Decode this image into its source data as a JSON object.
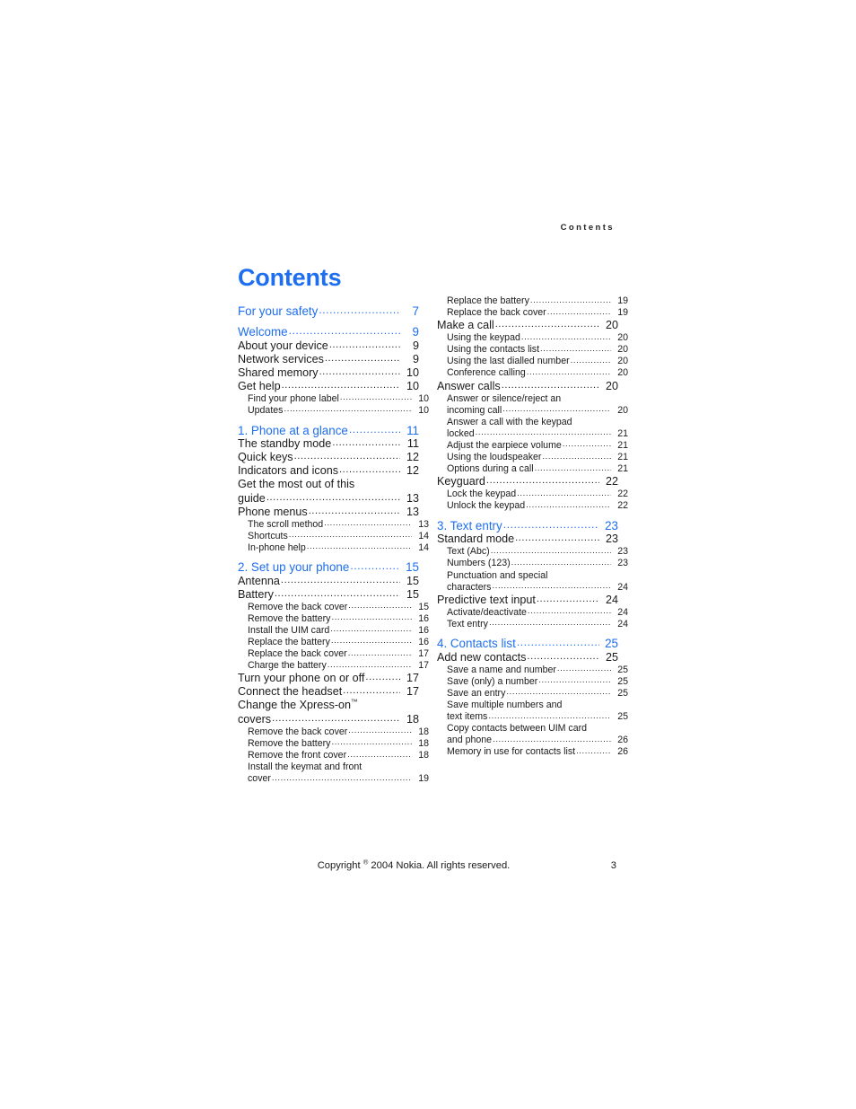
{
  "running_header": "Contents",
  "page_title": "Contents",
  "colors": {
    "chapter_blue": "#1d6ef0",
    "body_black": "#1a1a1a",
    "page_background": "#ffffff"
  },
  "footer": {
    "copyright": "Copyright © 2004 Nokia. All rights reserved.",
    "copyright_prefix": "Copyright ",
    "copyright_symbol": "®",
    "copyright_suffix": " 2004 Nokia. All rights reserved.",
    "folio": "3"
  },
  "toc": {
    "left_column": [
      {
        "level": "chapter",
        "label": "For your safety",
        "page": "7"
      },
      {
        "level": "chapter",
        "label": "Welcome",
        "page": "9"
      },
      {
        "level": "1",
        "label": "About your device",
        "page": "9"
      },
      {
        "level": "1",
        "label": "Network services",
        "page": "9"
      },
      {
        "level": "1",
        "label": "Shared memory ",
        "page": "10"
      },
      {
        "level": "1",
        "label": "Get help",
        "page": "10"
      },
      {
        "level": "2",
        "label": "Find your phone label",
        "page": "10"
      },
      {
        "level": "2",
        "label": "Updates",
        "page": "10"
      },
      {
        "level": "chapter",
        "label": "1. Phone at a glance",
        "page": "11"
      },
      {
        "level": "1",
        "label": "The standby mode",
        "page": "11"
      },
      {
        "level": "1",
        "label": "Quick keys",
        "page": "12"
      },
      {
        "level": "1",
        "label": "Indicators and icons",
        "page": "12"
      },
      {
        "level": "1",
        "label": "Get the most out of this",
        "wrap_first": true
      },
      {
        "level": "1",
        "label": "guide",
        "page": "13"
      },
      {
        "level": "1",
        "label": "Phone menus",
        "page": "13"
      },
      {
        "level": "2",
        "label": "The scroll method ",
        "page": "13"
      },
      {
        "level": "2",
        "label": "Shortcuts",
        "page": "14"
      },
      {
        "level": "2",
        "label": "In-phone help ",
        "page": "14"
      },
      {
        "level": "chapter",
        "label": "2. Set up your phone",
        "page": "15"
      },
      {
        "level": "1",
        "label": "Antenna ",
        "page": "15"
      },
      {
        "level": "1",
        "label": "Battery ",
        "page": "15"
      },
      {
        "level": "2",
        "label": "Remove the back cover ",
        "page": "15"
      },
      {
        "level": "2",
        "label": "Remove the battery",
        "page": "16"
      },
      {
        "level": "2",
        "label": "Install the UIM card ",
        "page": "16"
      },
      {
        "level": "2",
        "label": "Replace the battery",
        "page": "16"
      },
      {
        "level": "2",
        "label": "Replace the back cover ",
        "page": "17"
      },
      {
        "level": "2",
        "label": "Charge the battery ",
        "page": "17"
      },
      {
        "level": "1",
        "label": "Turn your phone on or off",
        "page": "17"
      },
      {
        "level": "1",
        "label": "Connect the headset",
        "page": "17"
      },
      {
        "level": "1",
        "label": "Change the Xpress-on",
        "superscript": "™",
        "wrap_first": true
      },
      {
        "level": "1",
        "label": "covers ",
        "page": "18"
      },
      {
        "level": "2",
        "label": "Remove the back cover ",
        "page": "18"
      },
      {
        "level": "2",
        "label": "Remove the battery",
        "page": "18"
      },
      {
        "level": "2",
        "label": "Remove the front cover ",
        "page": "18"
      },
      {
        "level": "2",
        "label": "Install the keymat and front",
        "wrap_first": true
      },
      {
        "level": "2",
        "label": "cover",
        "page": "19"
      }
    ],
    "right_column": [
      {
        "level": "2",
        "label": "Replace the battery",
        "page": "19"
      },
      {
        "level": "2",
        "label": "Replace the back cover ",
        "page": "19"
      },
      {
        "level": "1",
        "label": "Make a call",
        "page": "20"
      },
      {
        "level": "2",
        "label": "Using the keypad",
        "page": "20"
      },
      {
        "level": "2",
        "label": "Using the contacts list ",
        "page": "20"
      },
      {
        "level": "2",
        "label": "Using the last dialled number",
        "page": "20"
      },
      {
        "level": "2",
        "label": "Conference calling",
        "page": "20"
      },
      {
        "level": "1",
        "label": "Answer calls",
        "page": "20"
      },
      {
        "level": "2",
        "label": "Answer or silence/reject an",
        "wrap_first": true
      },
      {
        "level": "2",
        "label": "incoming call",
        "page": "20"
      },
      {
        "level": "2",
        "label": "Answer a call with the keypad",
        "wrap_first": true
      },
      {
        "level": "2",
        "label": "locked ",
        "page": "21"
      },
      {
        "level": "2",
        "label": "Adjust the earpiece volume ",
        "page": "21"
      },
      {
        "level": "2",
        "label": "Using the loudspeaker ",
        "page": "21"
      },
      {
        "level": "2",
        "label": "Options during a call",
        "page": "21"
      },
      {
        "level": "1",
        "label": "Keyguard ",
        "page": "22"
      },
      {
        "level": "2",
        "label": "Lock the keypad",
        "page": "22"
      },
      {
        "level": "2",
        "label": "Unlock the keypad ",
        "page": "22"
      },
      {
        "level": "chapter",
        "label": "3. Text entry ",
        "page": "23"
      },
      {
        "level": "1",
        "label": "Standard mode",
        "page": "23"
      },
      {
        "level": "2",
        "label": "Text (Abc) ",
        "page": "23"
      },
      {
        "level": "2",
        "label": "Numbers (123)",
        "page": "23"
      },
      {
        "level": "2",
        "label": "Punctuation and special",
        "wrap_first": true
      },
      {
        "level": "2",
        "label": "characters",
        "page": "24"
      },
      {
        "level": "1",
        "label": "Predictive text input",
        "page": "24"
      },
      {
        "level": "2",
        "label": "Activate/deactivate ",
        "page": "24"
      },
      {
        "level": "2",
        "label": "Text entry ",
        "page": "24"
      },
      {
        "level": "chapter",
        "label": "4. Contacts list ",
        "page": "25"
      },
      {
        "level": "1",
        "label": "Add new contacts",
        "page": "25"
      },
      {
        "level": "2",
        "label": "Save a name and number",
        "page": "25"
      },
      {
        "level": "2",
        "label": "Save (only) a number",
        "page": "25"
      },
      {
        "level": "2",
        "label": "Save an entry ",
        "page": "25"
      },
      {
        "level": "2",
        "label": "Save multiple numbers and",
        "wrap_first": true
      },
      {
        "level": "2",
        "label": "text items",
        "page": "25"
      },
      {
        "level": "2",
        "label": "Copy contacts between UIM card",
        "wrap_first": true
      },
      {
        "level": "2",
        "label": "and phone ",
        "page": "26"
      },
      {
        "level": "2",
        "label": "Memory in use for contacts list",
        "page": "26"
      }
    ]
  }
}
